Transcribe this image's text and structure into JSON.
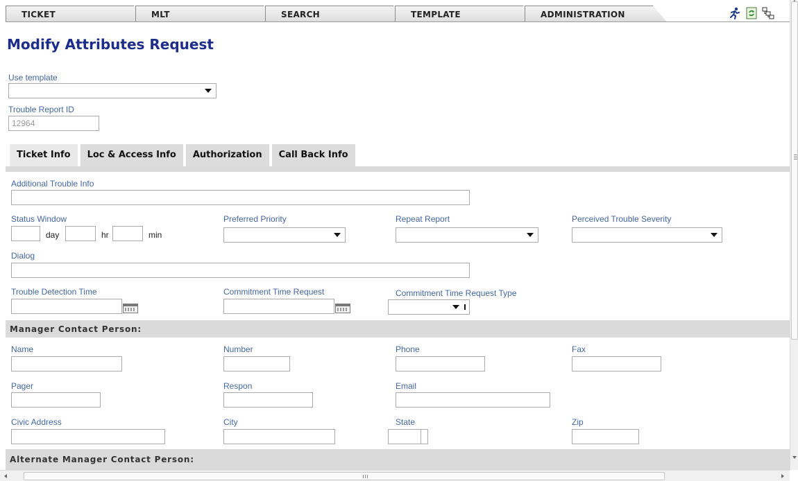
{
  "nav": {
    "tabs": [
      {
        "label": "TICKET"
      },
      {
        "label": "MLT"
      },
      {
        "label": "SEARCH"
      },
      {
        "label": "TEMPLATE"
      },
      {
        "label": "ADMINISTRATION"
      }
    ],
    "icons": [
      "runner-icon",
      "refresh-icon",
      "hierarchy-icon"
    ]
  },
  "page": {
    "title": "Modify Attributes Request"
  },
  "header_fields": {
    "use_template": {
      "label": "Use template",
      "value": ""
    },
    "trouble_report_id": {
      "label": "Trouble Report ID",
      "value": "12964"
    }
  },
  "subtabs": [
    {
      "label": "Ticket Info",
      "active": true
    },
    {
      "label": "Loc & Access Info",
      "active": false
    },
    {
      "label": "Authorization",
      "active": false
    },
    {
      "label": "Call Back Info",
      "active": false
    }
  ],
  "ticket_info": {
    "additional_trouble_info": {
      "label": "Additional Trouble Info",
      "value": ""
    },
    "status_window": {
      "label": "Status Window",
      "day_unit": "day",
      "hr_unit": "hr",
      "min_unit": "min"
    },
    "preferred_priority": {
      "label": "Preferred Priority",
      "value": ""
    },
    "repeat_report": {
      "label": "Repeat Report",
      "value": ""
    },
    "perceived_trouble_severity": {
      "label": "Perceived Trouble Severity",
      "value": ""
    },
    "dialog": {
      "label": "Dialog",
      "value": ""
    },
    "trouble_detection_time": {
      "label": "Trouble Detection Time",
      "value": ""
    },
    "commitment_time_request": {
      "label": "Commitment Time Request",
      "value": ""
    },
    "commitment_time_request_type": {
      "label": "Commitment Time Request Type",
      "value": ""
    }
  },
  "manager_contact": {
    "title": "Manager Contact Person:",
    "name": "Name",
    "number": "Number",
    "phone": "Phone",
    "fax": "Fax",
    "pager": "Pager",
    "respon": "Respon",
    "email": "Email",
    "civic_address": "Civic Address",
    "city": "City",
    "state": "State",
    "zip": "Zip"
  },
  "alternate_manager_contact": {
    "title": "Alternate Manager Contact Person:"
  },
  "colors": {
    "title": "#1f2d8a",
    "label": "#4466a0",
    "section_bar": "#dadada"
  }
}
